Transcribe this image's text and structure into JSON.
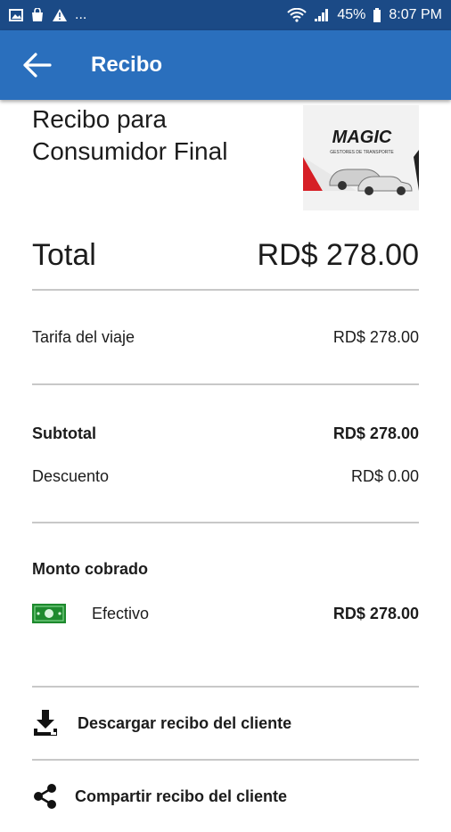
{
  "status_bar": {
    "left_icons": [
      "image-icon",
      "shopping-bag-icon",
      "warning-icon"
    ],
    "ellipsis": "...",
    "battery_percent": "45%",
    "time": "8:07 PM"
  },
  "app_bar": {
    "title": "Recibo"
  },
  "receipt": {
    "title": "Recibo para Consumidor Final",
    "logo_text": "MAGIC",
    "logo_subtext": "GESTORES DE TRANSPORTE",
    "total_label": "Total",
    "total_value": "RD$ 278.00",
    "fare_label": "Tarifa del viaje",
    "fare_value": "RD$ 278.00",
    "subtotal_label": "Subtotal",
    "subtotal_value": "RD$ 278.00",
    "discount_label": "Descuento",
    "discount_value": "RD$ 0.00",
    "charged_label": "Monto cobrado",
    "payment_method": "Efectivo",
    "payment_value": "RD$ 278.00"
  },
  "actions": {
    "download_label": "Descargar recibo del cliente",
    "share_label": "Compartir recibo del cliente"
  },
  "colors": {
    "status_bar": "#1b4a86",
    "app_bar": "#2a6fbd",
    "cash_green": "#1e8a2e"
  }
}
